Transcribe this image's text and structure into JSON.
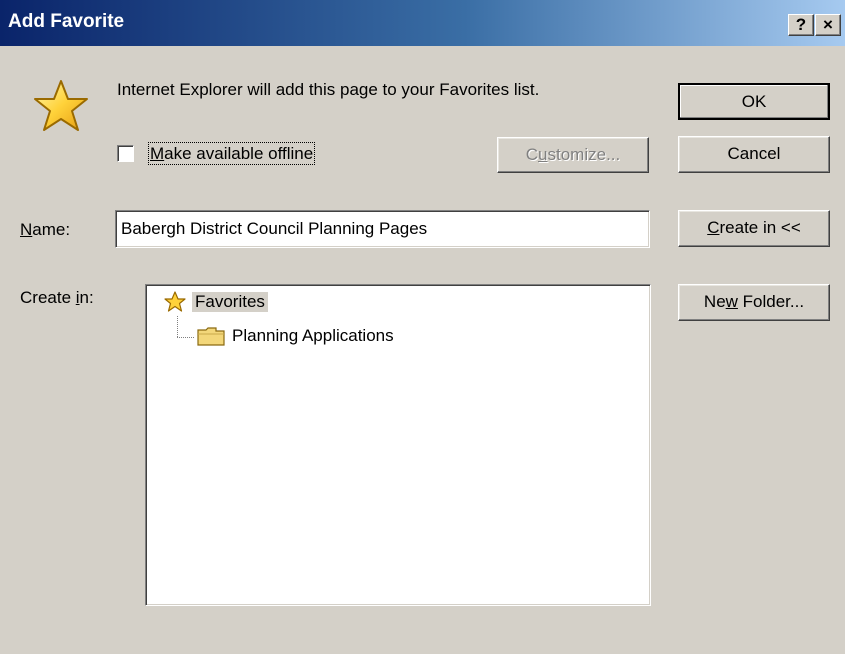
{
  "window": {
    "title": "Add Favorite",
    "help_button": "?",
    "close_button": "×"
  },
  "message": "Internet Explorer will add this page to your Favorites list.",
  "offline_checkbox": {
    "label_prefix": "",
    "label_underlined": "M",
    "label_rest": "ake available offline",
    "checked": false
  },
  "buttons": {
    "ok": "OK",
    "cancel": "Cancel",
    "customize_pre": "C",
    "customize_u": "u",
    "customize_post": "stomize...",
    "create_in_u": "C",
    "create_in_post": "reate in <<",
    "new_folder_pre": "Ne",
    "new_folder_u": "w",
    "new_folder_post": " Folder..."
  },
  "name_field": {
    "label_u": "N",
    "label_post": "ame:",
    "value": "Babergh District Council Planning Pages"
  },
  "create_in": {
    "label_pre": "Create ",
    "label_u": "i",
    "label_post": "n:",
    "tree": [
      {
        "label": "Favorites",
        "icon": "star-icon",
        "selected": true
      },
      {
        "label": "Planning Applications",
        "icon": "folder-icon",
        "selected": false
      }
    ]
  },
  "colors": {
    "dialog_bg": "#d4d0c8",
    "title_start": "#0a246a",
    "title_end": "#a6caf0"
  }
}
